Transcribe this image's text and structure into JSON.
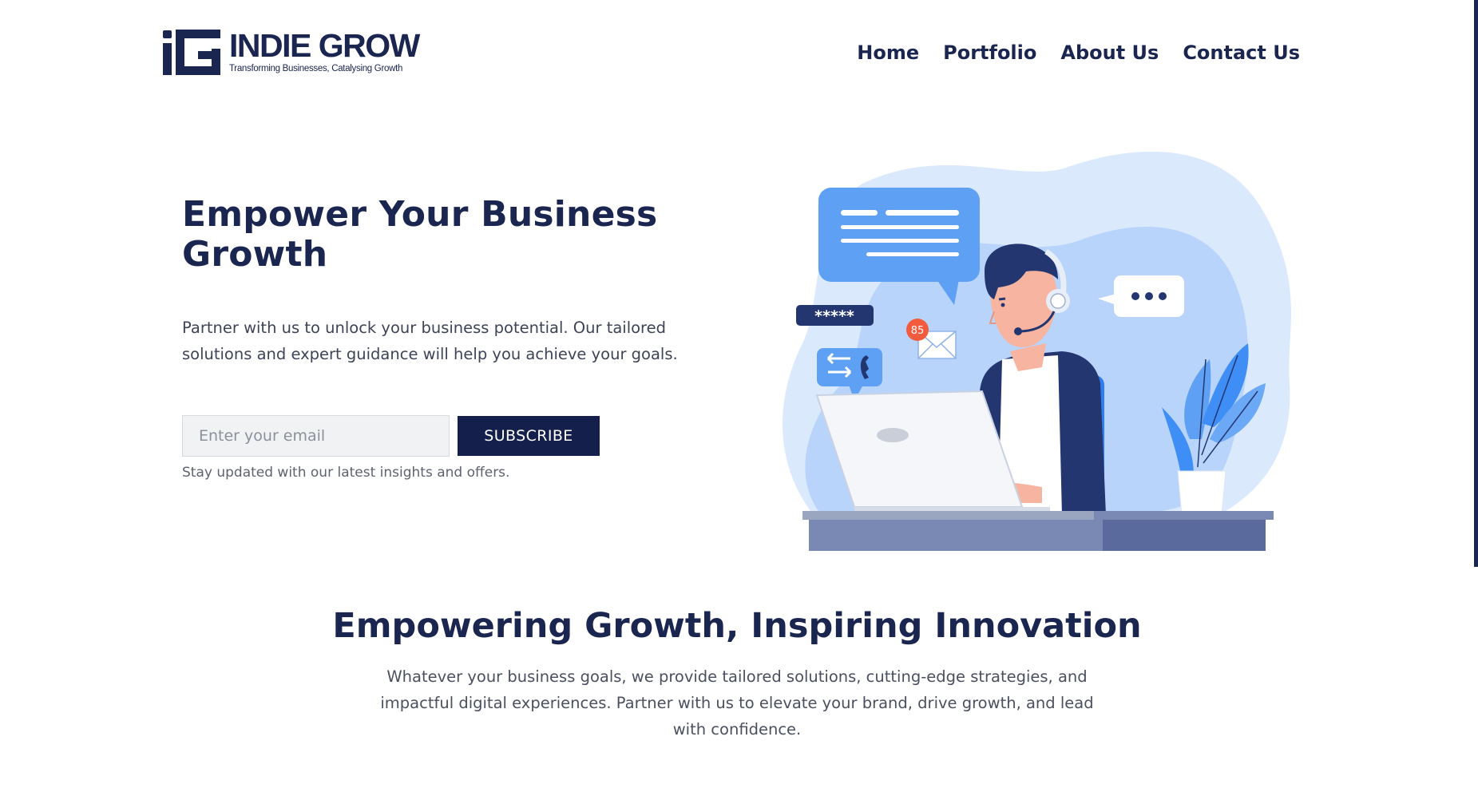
{
  "brand": {
    "name": "INDIE GROW",
    "tagline": "Transforming Businesses, Catalysing Growth",
    "primary_color": "#1a2550",
    "accent_color": "#3f8ef5"
  },
  "nav": {
    "items": [
      {
        "label": "Home"
      },
      {
        "label": "Portfolio"
      },
      {
        "label": "About Us"
      },
      {
        "label": "Contact Us"
      }
    ]
  },
  "hero": {
    "title": "Empower Your Business Growth",
    "text": "Partner with us to unlock your business potential. Our tailored solutions and expert guidance will help you achieve your goals.",
    "email_placeholder": "Enter your email",
    "subscribe_label": "SUBSCRIBE",
    "note": "Stay updated with our latest insights and offers.",
    "illustration": {
      "password_mask": "*****",
      "notification_count": "85",
      "icons": [
        "chat-bubble-icon",
        "typing-bubble-icon",
        "password-field-icon",
        "envelope-icon",
        "phone-transfer-icon",
        "headset-icon",
        "laptop-icon",
        "plant-icon"
      ]
    }
  },
  "section": {
    "title": "Empowering Growth, Inspiring Innovation",
    "text": "Whatever your business goals, we provide tailored solutions, cutting-edge strategies, and impactful digital experiences. Partner with us to elevate your brand, drive growth, and lead with confidence."
  }
}
